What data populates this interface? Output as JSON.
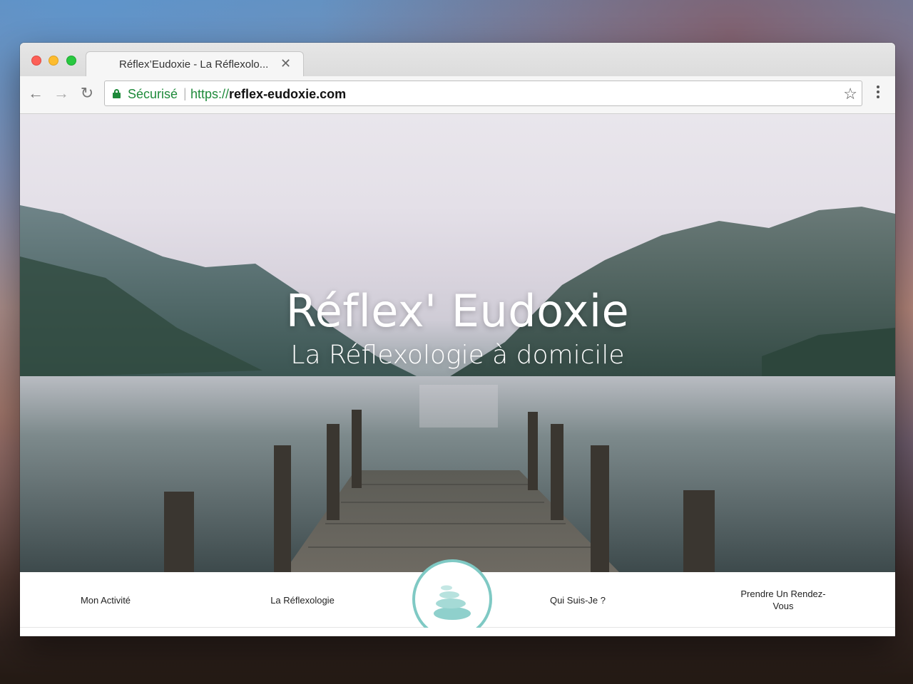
{
  "browser": {
    "tab_title": "Réflex’Eudoxie - La Réflexolo...",
    "tab_close": "✕",
    "back": "←",
    "forward": "→",
    "reload": "↻",
    "secure_label": "Sécurisé",
    "url_separator": "|",
    "url_scheme": "https://",
    "url_host": "reflex-eudoxie.com",
    "bookmark": "☆"
  },
  "hero": {
    "title": "Réflex' Eudoxie",
    "subtitle": "La Réflexologie à domicile"
  },
  "nav": {
    "items": [
      {
        "label": "Mon Activité"
      },
      {
        "label": "La Réflexologie"
      },
      {
        "label": "Qui Suis-Je ?"
      },
      {
        "label": "Prendre Un Rendez-Vous"
      }
    ]
  },
  "colors": {
    "accent": "#7fc9c4",
    "secure_green": "#1e8a3a"
  },
  "icons": {
    "logo": "stacked-stones-icon"
  }
}
